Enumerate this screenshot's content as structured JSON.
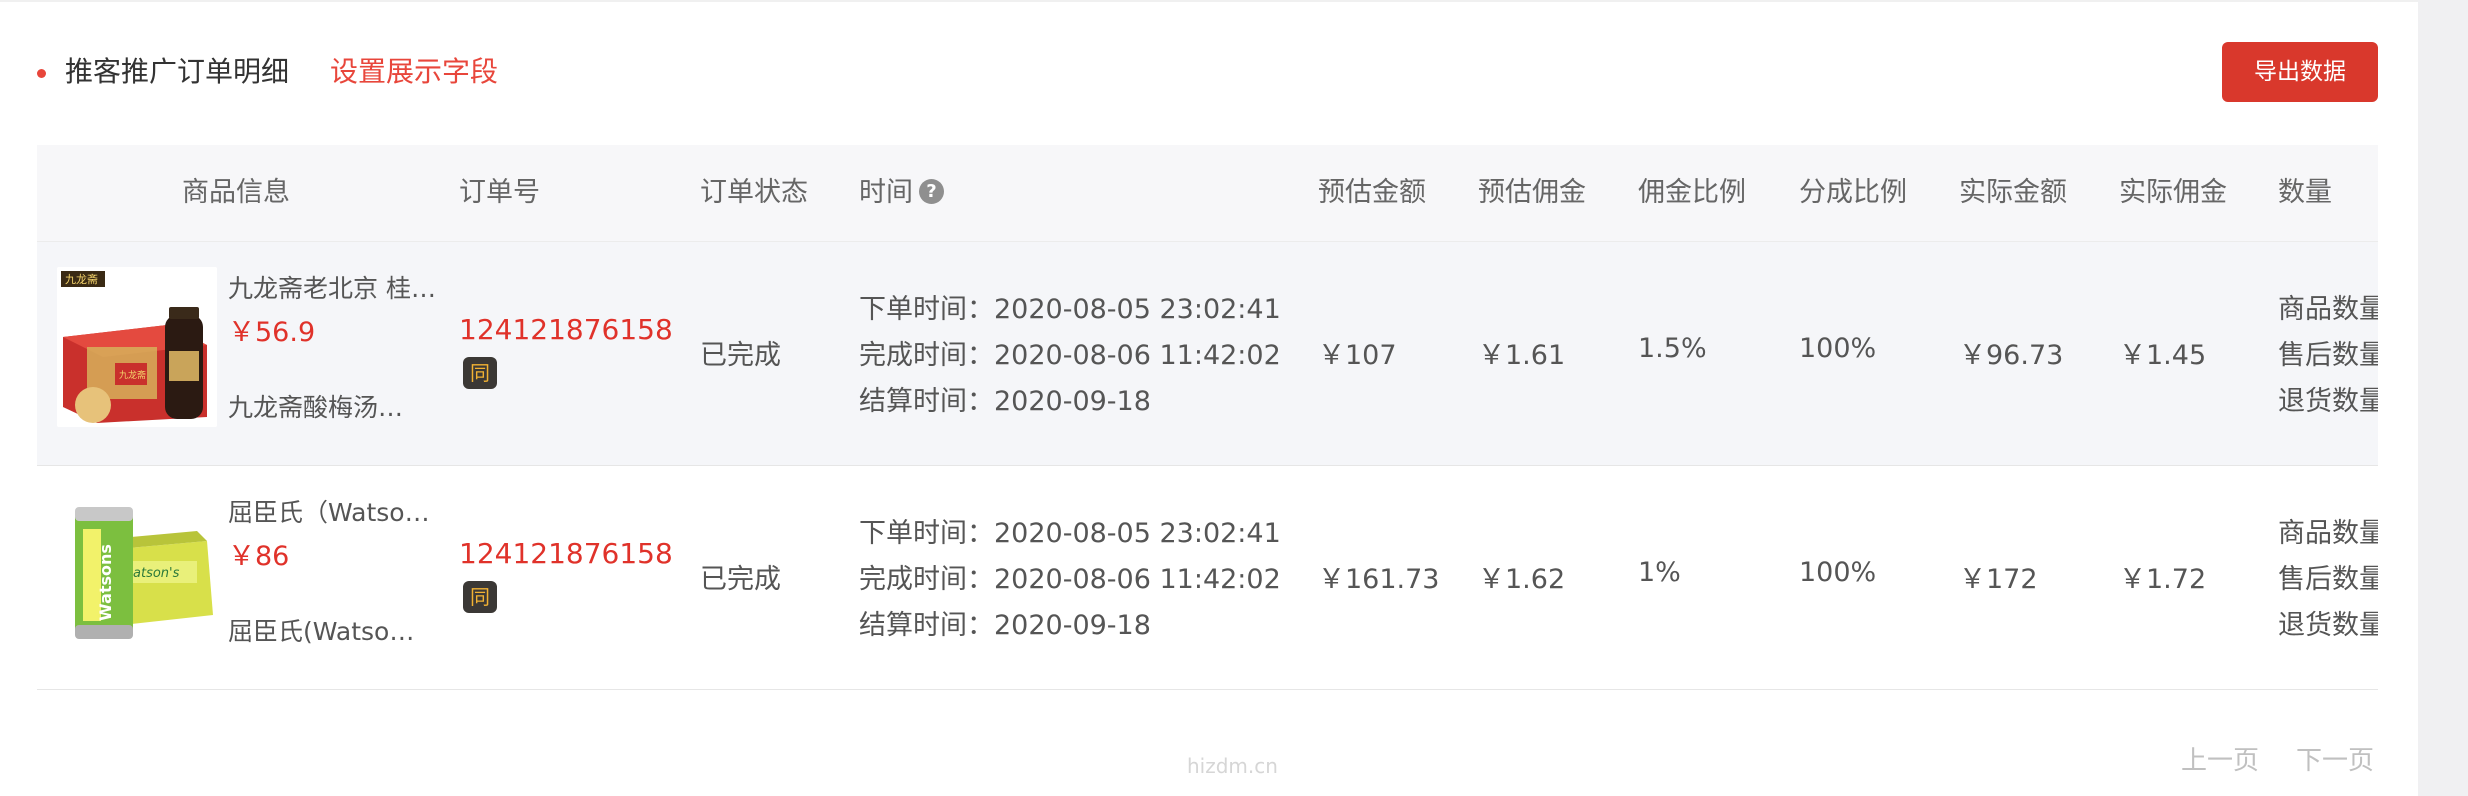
{
  "header": {
    "title": "推客推广订单明细",
    "settings_link": "设置展示字段",
    "export_button": "导出数据"
  },
  "table": {
    "columns": [
      "商品信息",
      "订单号",
      "订单状态",
      "时间",
      "预估金额",
      "预估佣金",
      "佣金比例",
      "分成比例",
      "实际金额",
      "实际佣金",
      "数量"
    ],
    "help_glyph": "?",
    "rows": [
      {
        "product_name": "九龙斋老北京 桂…",
        "price": "￥56.9",
        "shop": "九龙斋酸梅汤京…",
        "order_no": "124121876158",
        "tag": "同",
        "status": "已完成",
        "order_time": "下单时间：2020-08-05 23:02:41",
        "complete_time": "完成时间：2020-08-06 11:42:02",
        "settle_time": "结算时间：2020-09-18",
        "est_amount": "￥107",
        "est_commission": "￥1.61",
        "commission_rate": "1.5%",
        "share_rate": "100%",
        "actual_amount": "￥96.73",
        "actual_commission": "￥1.45",
        "qty_goods": "商品数量",
        "qty_aftersale": "售后数量",
        "qty_return": "退货数量",
        "thumb_logo": "九龙斋",
        "thumb_label": "九龙斋"
      },
      {
        "product_name": "屈臣氏（Watsons…",
        "price": "￥86",
        "shop": "屈臣氏(Watson'…",
        "order_no": "124121876158",
        "tag": "同",
        "status": "已完成",
        "order_time": "下单时间：2020-08-05 23:02:41",
        "complete_time": "完成时间：2020-08-06 11:42:02",
        "settle_time": "结算时间：2020-09-18",
        "est_amount": "￥161.73",
        "est_commission": "￥1.62",
        "commission_rate": "1%",
        "share_rate": "100%",
        "actual_amount": "￥172",
        "actual_commission": "￥1.72",
        "qty_goods": "商品数量",
        "qty_aftersale": "售后数量",
        "qty_return": "退货数量",
        "thumb_can_label": "Watsons",
        "thumb_box_label": "atson's"
      }
    ]
  },
  "watermark": "hizdm.cn",
  "pagination": {
    "prev": "上一页",
    "next": "下一页"
  },
  "colors": {
    "accent": "#e8463b",
    "button": "#d9382c",
    "price": "#e0322a"
  }
}
